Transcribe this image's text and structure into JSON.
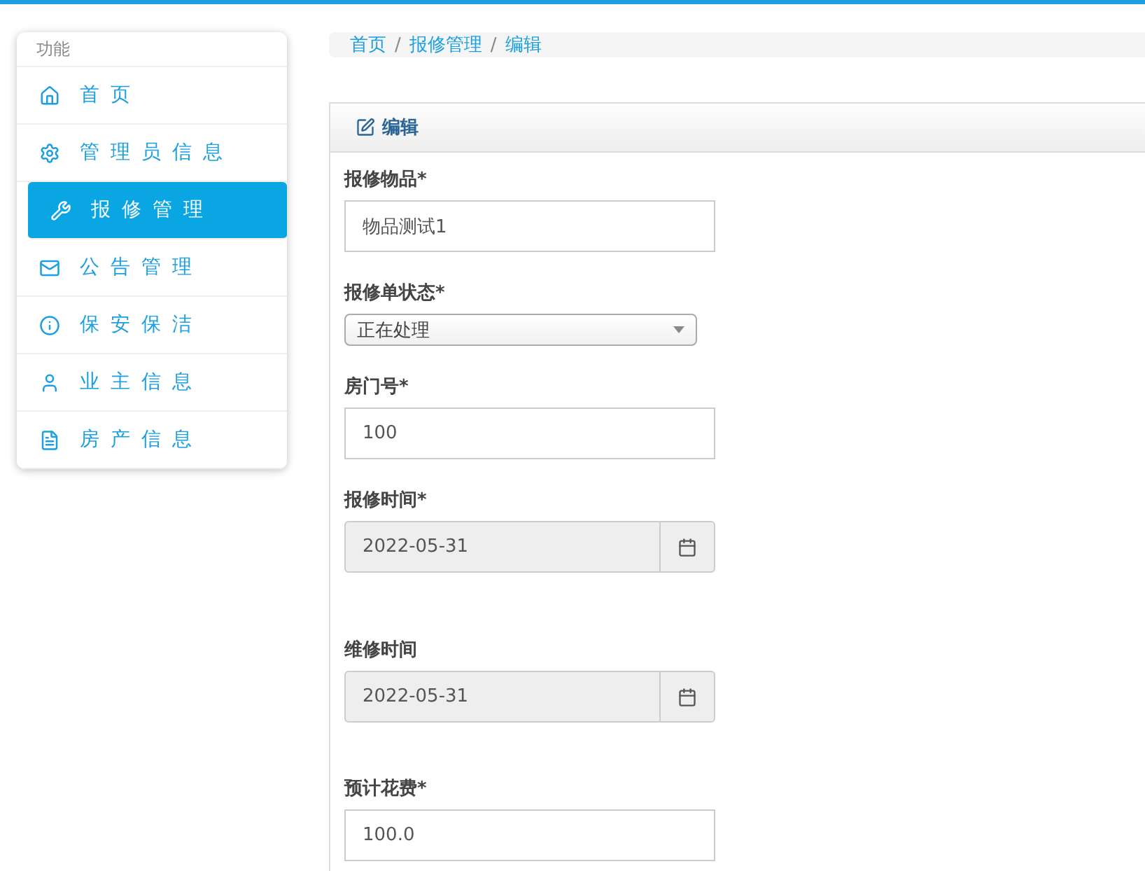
{
  "sidebar": {
    "title": "功能",
    "items": [
      {
        "label": "首页",
        "selected": false
      },
      {
        "label": "管理员信息",
        "selected": false
      },
      {
        "label": "报修管理",
        "selected": true
      },
      {
        "label": "公告管理",
        "selected": false
      },
      {
        "label": "保安保洁",
        "selected": false
      },
      {
        "label": "业主信息",
        "selected": false
      },
      {
        "label": "房产信息",
        "selected": false
      }
    ]
  },
  "breadcrumb": [
    {
      "kind": "link",
      "text": "首页"
    },
    {
      "kind": "separator",
      "text": "/"
    },
    {
      "kind": "link",
      "text": "报修管理"
    },
    {
      "kind": "separator",
      "text": "/"
    },
    {
      "kind": "link",
      "text": "编辑"
    }
  ],
  "panel": {
    "title": "编辑",
    "fields": [
      {
        "kind": "text",
        "label": "报修物品*",
        "value": "物品测试1"
      },
      {
        "kind": "select",
        "label": "报修单状态*",
        "value": "正在处理"
      },
      {
        "kind": "text",
        "label": "房门号*",
        "value": "100"
      },
      {
        "kind": "date",
        "label": "报修时间*",
        "value": "2022-05-31"
      },
      {
        "kind": "date",
        "label": "维修时间",
        "value": "2022-05-31"
      },
      {
        "kind": "text",
        "label": "预计花费*",
        "value": "100.0"
      }
    ]
  }
}
